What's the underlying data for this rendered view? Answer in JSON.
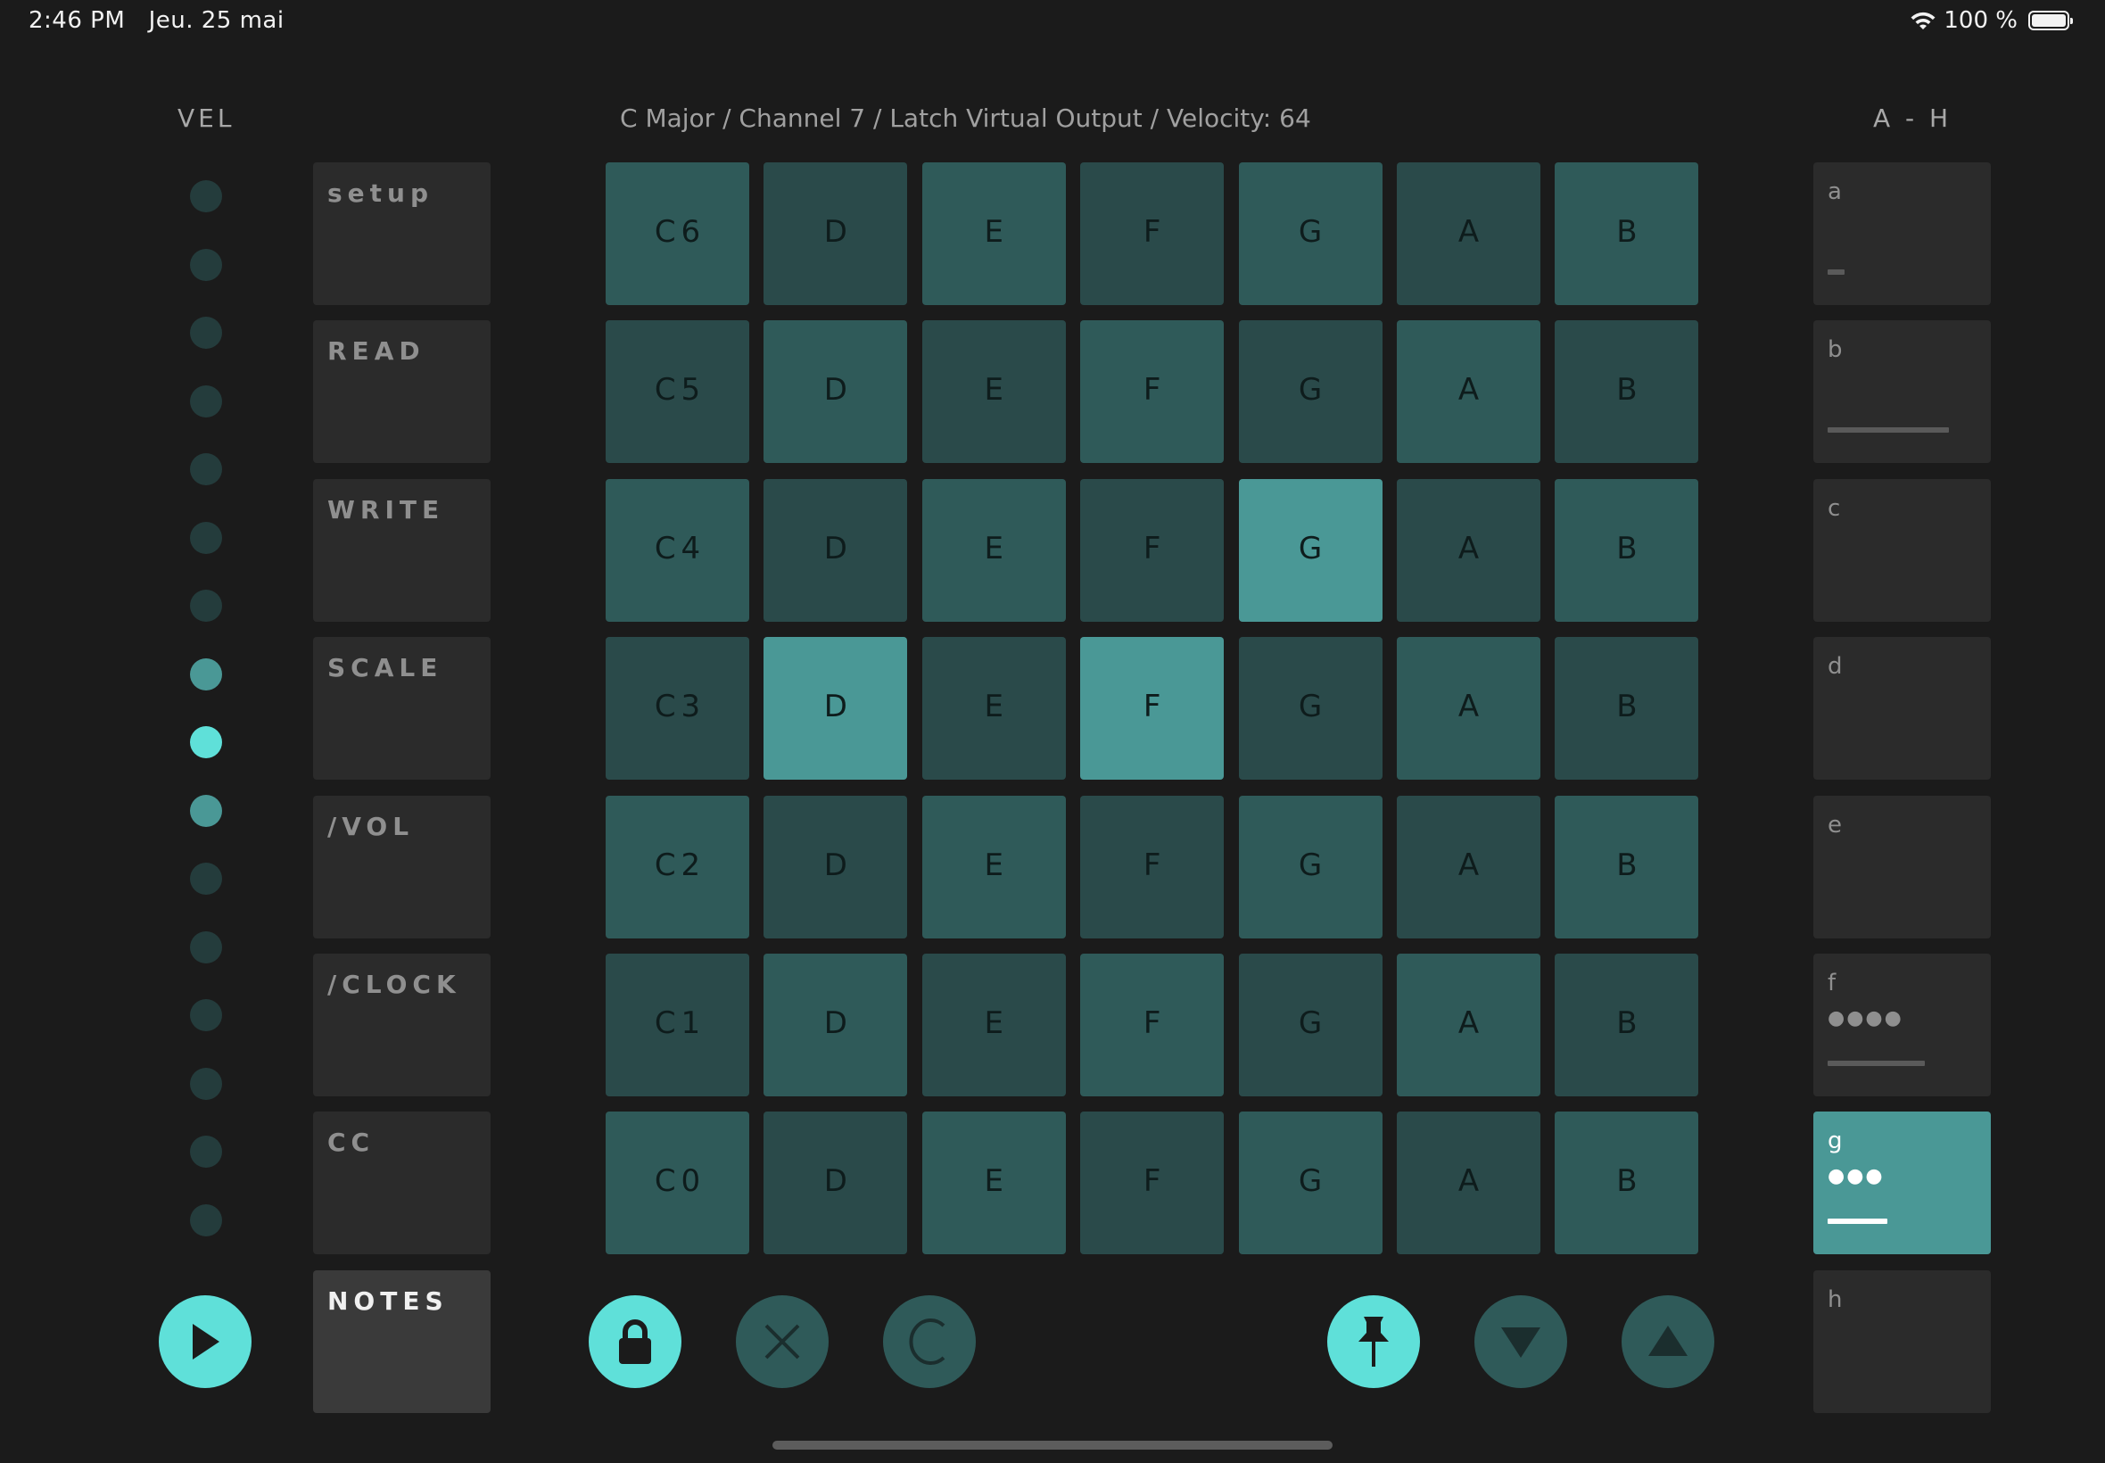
{
  "status": {
    "time": "2:46 PM",
    "date": "Jeu. 25 mai",
    "battery": "100 %"
  },
  "headers": {
    "vel": "VEL",
    "main": "C Major / Channel 7 / Latch Virtual Output / Velocity: 64",
    "ah": "A - H"
  },
  "velocity_levels": 16,
  "velocity_lit": [
    7,
    8,
    9
  ],
  "menu": [
    {
      "label": "setup"
    },
    {
      "label": "READ"
    },
    {
      "label": "WRITE"
    },
    {
      "label": "SCALE"
    },
    {
      "label": "/VOL"
    },
    {
      "label": "/CLOCK"
    },
    {
      "label": "CC"
    },
    {
      "label": "NOTES",
      "active": true
    }
  ],
  "grid": {
    "rows": [
      [
        "C6",
        "D",
        "E",
        "F",
        "G",
        "A",
        "B"
      ],
      [
        "C5",
        "D",
        "E",
        "F",
        "G",
        "A",
        "B"
      ],
      [
        "C4",
        "D",
        "E",
        "F",
        "G",
        "A",
        "B"
      ],
      [
        "C3",
        "D",
        "E",
        "F",
        "G",
        "A",
        "B"
      ],
      [
        "C2",
        "D",
        "E",
        "F",
        "G",
        "A",
        "B"
      ],
      [
        "C1",
        "D",
        "E",
        "F",
        "G",
        "A",
        "B"
      ],
      [
        "C0",
        "D",
        "E",
        "F",
        "G",
        "A",
        "B"
      ]
    ],
    "active": [
      [
        2,
        4
      ],
      [
        3,
        1
      ],
      [
        3,
        3
      ]
    ]
  },
  "slots": [
    {
      "label": "a",
      "bar": 0.12
    },
    {
      "label": "b",
      "bar": 0.85
    },
    {
      "label": "c"
    },
    {
      "label": "d"
    },
    {
      "label": "e"
    },
    {
      "label": "f",
      "dots": "●●●●",
      "bar": 0.68
    },
    {
      "label": "g",
      "dots": "●●●",
      "bar": 0.42,
      "active": true
    },
    {
      "label": "h"
    }
  ],
  "controls": {
    "play": "play-icon",
    "lock": "lock-icon",
    "clear": "close-icon",
    "reset": "c-icon",
    "pin": "pin-icon",
    "down": "triangle-down-icon",
    "up": "triangle-up-icon"
  },
  "colors": {
    "accent": "#5fe0d9",
    "pad": "#2f5a59",
    "pad_on": "#4a9896"
  }
}
